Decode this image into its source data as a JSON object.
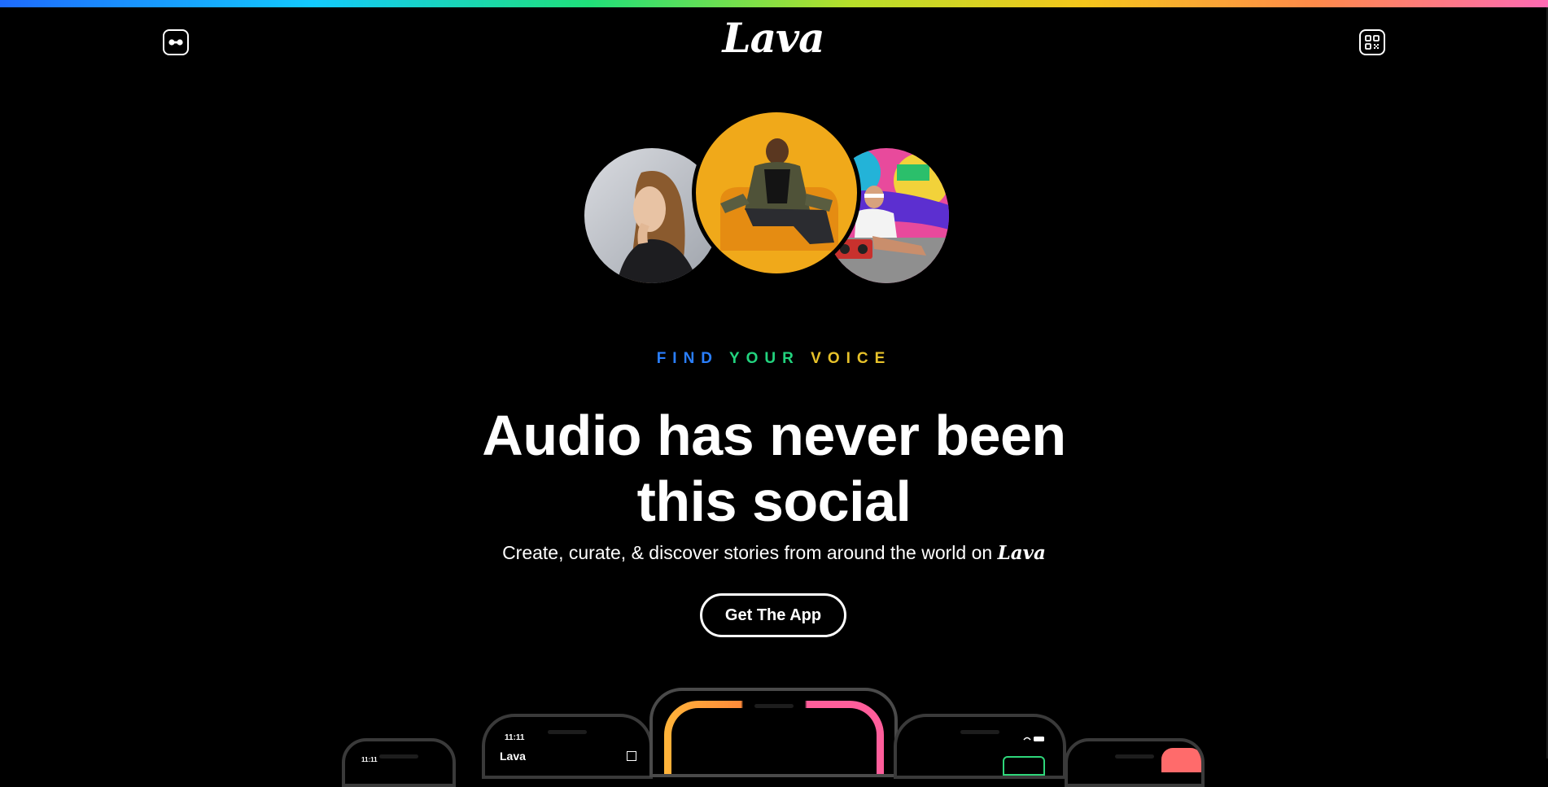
{
  "brand": {
    "logo_text": "Lava"
  },
  "header": {
    "menu_icon": "infinity-toggle-icon",
    "qr_icon": "qr-code-icon"
  },
  "hero": {
    "eyebrow_words": [
      "FIND",
      "YOUR",
      "VOICE"
    ],
    "eyebrow_colors": [
      "#2a7fff",
      "#22d37e",
      "#e7c22a"
    ],
    "headline_line1": "Audio has never been",
    "headline_line2": "this social",
    "subline": "Create, curate, & discover stories from around the world on",
    "subline_brand": "Lava",
    "cta_label": "Get The App"
  },
  "phones": {
    "left_time": "11:11",
    "left_app_title": "Lava",
    "far_left_time": "11:11"
  },
  "colors": {
    "accent_orange": "#ffb43a",
    "accent_pink": "#ff5e9b",
    "accent_green": "#2ed67a"
  }
}
